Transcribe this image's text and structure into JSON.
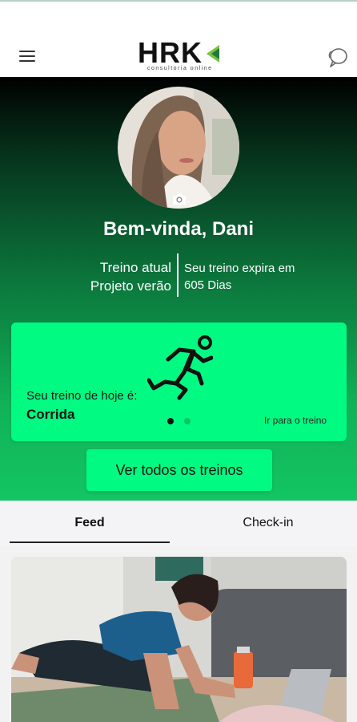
{
  "header": {
    "logo_text": "HRK",
    "logo_subtitle": "consultoria online",
    "menu_icon": "hamburger-menu-icon",
    "chat_icon": "chat-bubbles-icon"
  },
  "profile": {
    "welcome": "Bem-vinda, Dani",
    "current_training_label": "Treino atual",
    "current_training_name": "Projeto verão",
    "expires_label": "Seu treino expira em",
    "expires_value": "605 Dias"
  },
  "today_card": {
    "label": "Seu treino de hoje é:",
    "workout": "Corrida",
    "go_link": "Ir para o treino",
    "icon": "running-person-icon",
    "pages": 2,
    "active_page": 1
  },
  "all_trainings_button": "Ver todos os treinos",
  "tabs": [
    {
      "label": "Feed",
      "active": true
    },
    {
      "label": "Check-in",
      "active": false
    }
  ],
  "colors": {
    "accent": "#00fa82",
    "hero_top": "#000000",
    "hero_bottom": "#13c563"
  }
}
